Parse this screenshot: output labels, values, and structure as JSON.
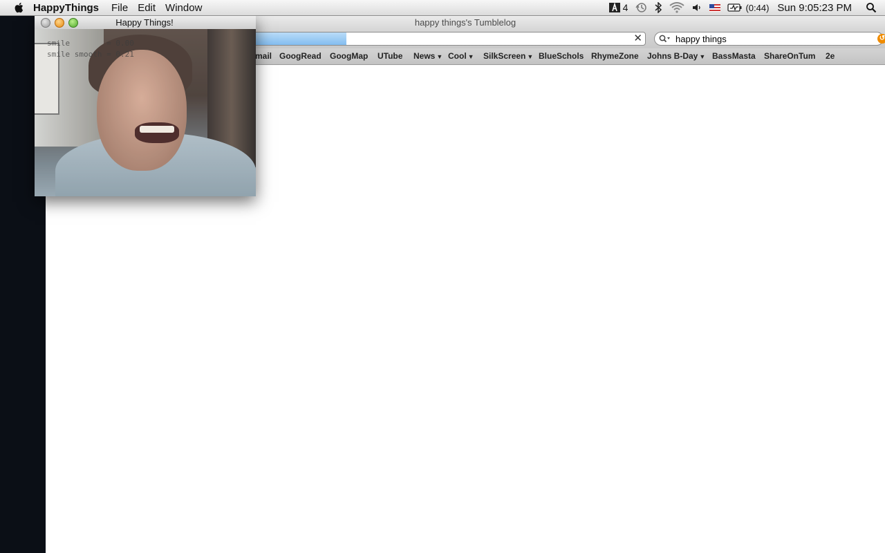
{
  "menubar": {
    "app_name": "HappyThings",
    "items": [
      "File",
      "Edit",
      "Window"
    ],
    "status": {
      "adobe_count": "4",
      "battery_time": "(0:44)",
      "clock": "Sun 9:05:23 PM"
    }
  },
  "safari": {
    "window_title": "happy things's Tumblelog",
    "url": "",
    "search_value": "happy things",
    "bookmarks": [
      {
        "label": "mail",
        "menu": false
      },
      {
        "label": "GoogRead",
        "menu": false
      },
      {
        "label": "GoogMap",
        "menu": false
      },
      {
        "label": "UTube",
        "menu": false
      },
      {
        "label": "News",
        "menu": true
      },
      {
        "label": "Cool",
        "menu": true
      },
      {
        "label": "SilkScreen",
        "menu": true
      },
      {
        "label": "BlueSchols",
        "menu": false
      },
      {
        "label": "RhymeZone",
        "menu": false
      },
      {
        "label": "Johns B-Day",
        "menu": true
      },
      {
        "label": "BassMasta",
        "menu": false
      },
      {
        "label": "ShareOnTum",
        "menu": false
      },
      {
        "label": "2e",
        "menu": false
      }
    ]
  },
  "happy_window": {
    "title": "Happy Things!",
    "overlay_line1": "smile        = 0.00",
    "overlay_line2": "smile smooth = 0.21"
  },
  "icons": {
    "apple": "apple-logo",
    "adobe": "adobe-icon",
    "time_machine": "time-machine-icon",
    "bluetooth": "bluetooth-icon",
    "wifi": "wifi-icon",
    "volume": "volume-icon",
    "input": "us-flag-icon",
    "battery": "battery-icon",
    "spotlight": "spotlight-icon"
  }
}
